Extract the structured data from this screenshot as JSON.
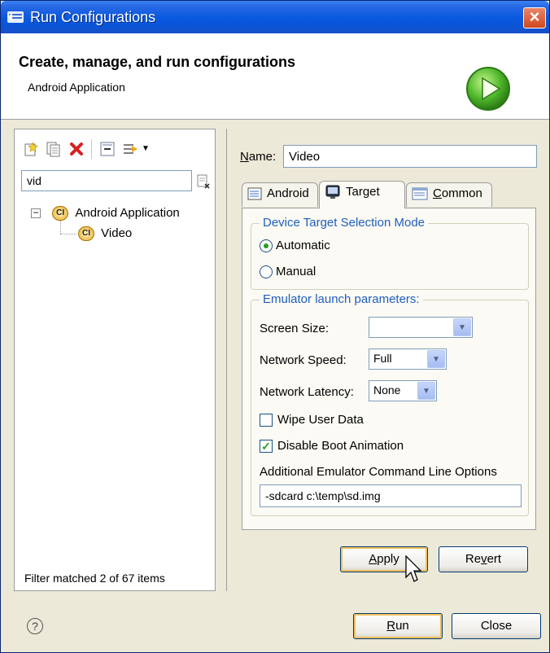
{
  "window": {
    "title": "Run Configurations"
  },
  "header": {
    "title": "Create, manage, and run configurations",
    "subtitle": "Android Application"
  },
  "left": {
    "filter_value": "vid",
    "tree": [
      {
        "label": "Android Application",
        "expanded": true
      },
      {
        "label": "Video"
      }
    ],
    "status": "Filter matched 2 of 67 items",
    "toolbar_icons": [
      "new-launch-config-icon",
      "duplicate-icon",
      "delete-icon",
      "collapse-all-icon",
      "filter-icon"
    ]
  },
  "right": {
    "name_label": "Name:",
    "name_value": "Video",
    "tabs": [
      {
        "label": "Android",
        "icon": "android-tab-icon"
      },
      {
        "label": "Target",
        "icon": "target-tab-icon",
        "active": true
      },
      {
        "label": "Common",
        "icon": "common-tab-icon"
      }
    ],
    "target": {
      "mode_group": "Device Target Selection Mode",
      "mode_automatic": "Automatic",
      "mode_manual": "Manual",
      "mode_selected": "Automatic",
      "emulator_group": "Emulator launch parameters:",
      "screen_size_label": "Screen Size:",
      "screen_size_value": "",
      "network_speed_label": "Network Speed:",
      "network_speed_value": "Full",
      "network_latency_label": "Network Latency:",
      "network_latency_value": "None",
      "wipe_user_data": "Wipe User Data",
      "wipe_user_data_checked": false,
      "disable_boot_animation": "Disable Boot Animation",
      "disable_boot_animation_checked": true,
      "cmdline_label": "Additional Emulator Command Line Options",
      "cmdline_value": "-sdcard c:\\temp\\sd.img"
    },
    "apply_button": "Apply",
    "revert_button": "Revert"
  },
  "footer": {
    "run_button": "Run",
    "close_button": "Close"
  }
}
